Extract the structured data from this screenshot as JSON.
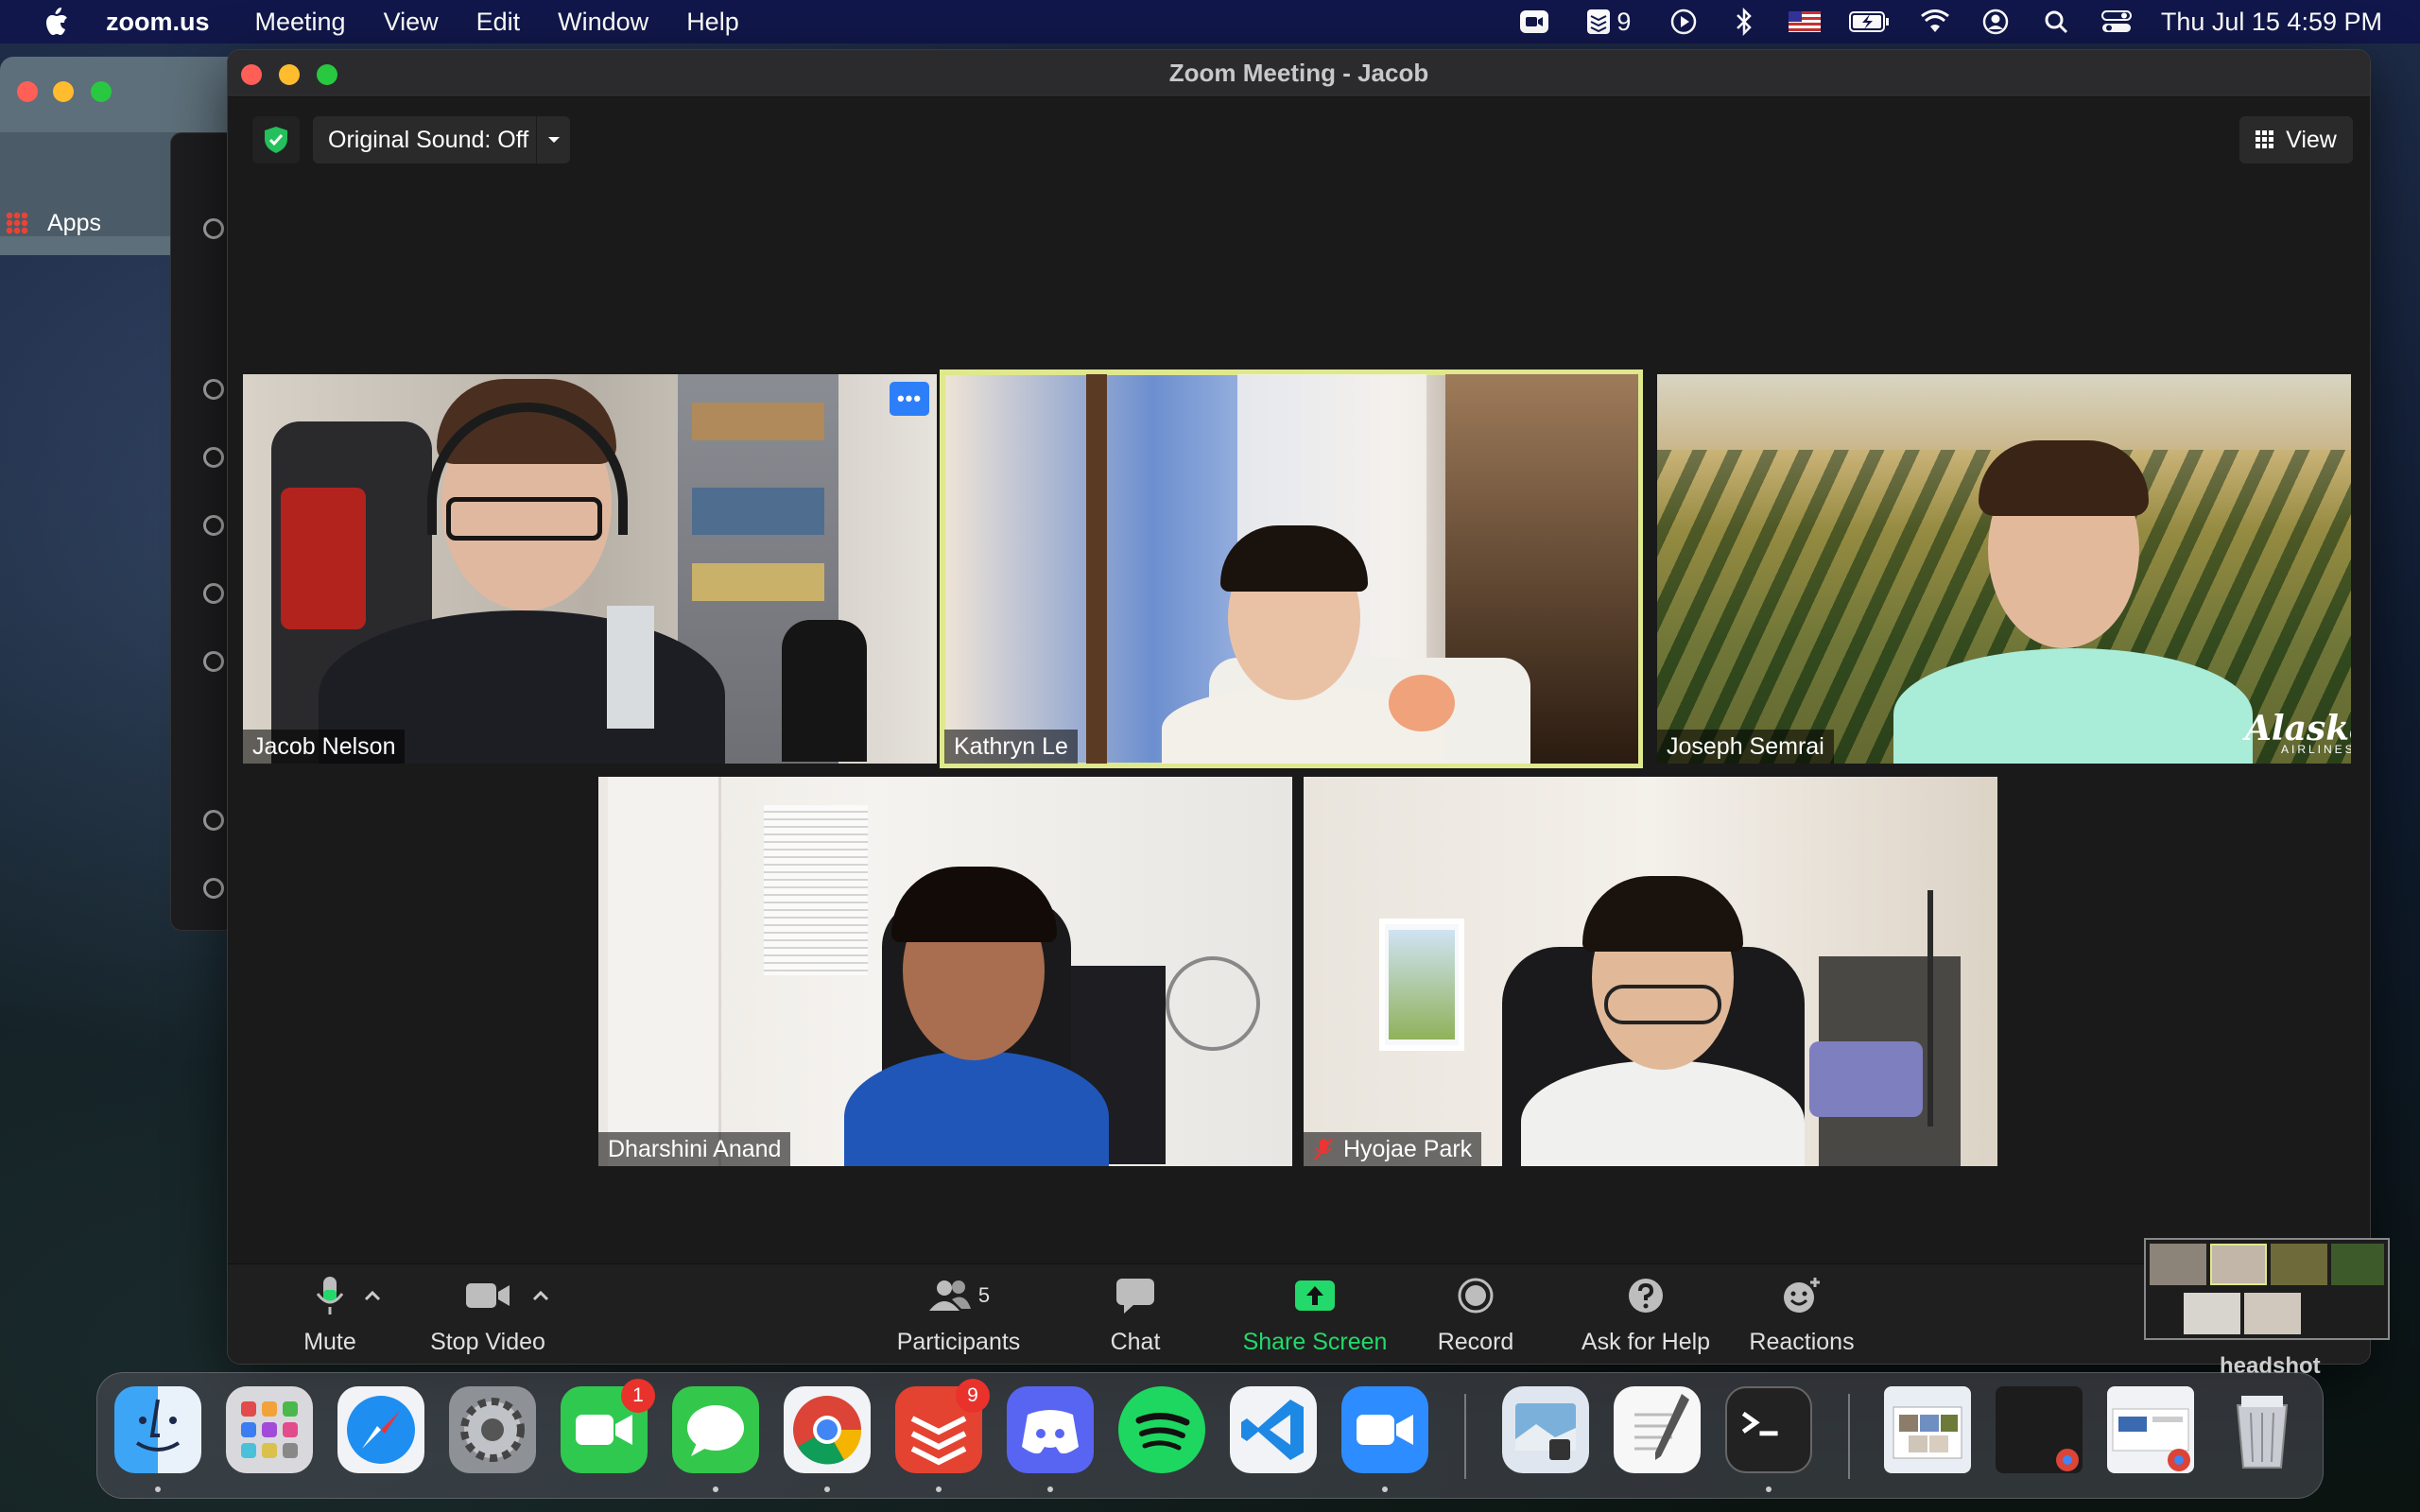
{
  "menubar": {
    "app_name": "zoom.us",
    "menus": [
      "Meeting",
      "View",
      "Edit",
      "Window",
      "Help"
    ],
    "notification_count": "9",
    "clock": "Thu Jul 15  4:59 PM"
  },
  "browser": {
    "bookmark_label": "Apps"
  },
  "window": {
    "title": "Zoom Meeting - Jacob"
  },
  "meeting": {
    "original_sound_label": "Original Sound: Off",
    "view_label": "View",
    "more_label": "•••",
    "participants": [
      {
        "name": "Jacob Nelson"
      },
      {
        "name": "Kathryn Le"
      },
      {
        "name": "Joseph Semrai"
      },
      {
        "name": "Dharshini Anand"
      },
      {
        "name": "Hyojae Park"
      }
    ],
    "background_logo": "Alaska",
    "background_logo_sub": "AIRLINES"
  },
  "toolbar": {
    "mute": "Mute",
    "stop_video": "Stop Video",
    "participants": "Participants",
    "participants_count": "5",
    "chat": "Chat",
    "share_screen": "Share Screen",
    "record": "Record",
    "ask_for_help": "Ask for Help",
    "reactions": "Reactions"
  },
  "thumbnail": {
    "label": "headshot"
  },
  "dock": {
    "facetime_badge": "1",
    "todoist_badge": "9"
  },
  "colors": {
    "active_speaker": "#dfe88c",
    "share_green": "#23d96b",
    "menubar_bg": "#11174a"
  }
}
